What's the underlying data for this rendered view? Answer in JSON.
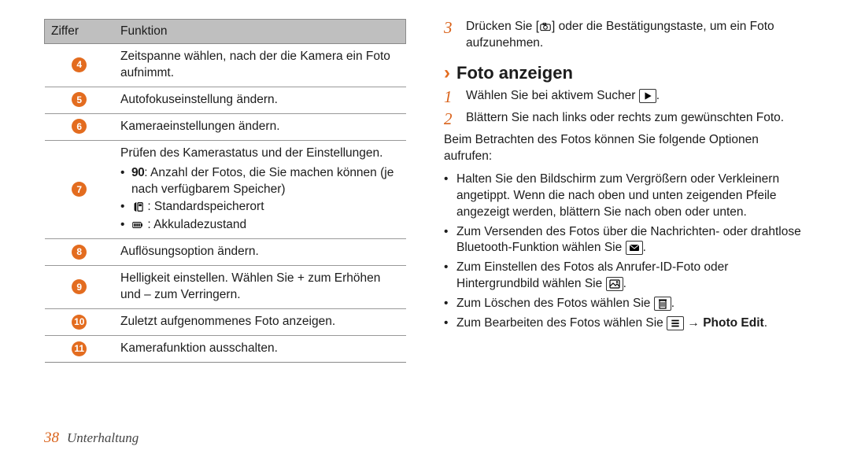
{
  "table": {
    "head": {
      "ziffer": "Ziffer",
      "funktion": "Funktion"
    },
    "rows": [
      {
        "n": "4",
        "text": "Zeitspanne wählen, nach der die Kamera ein Foto aufnimmt."
      },
      {
        "n": "5",
        "text": "Autofokuseinstellung ändern."
      },
      {
        "n": "6",
        "text": "Kameraeinstellungen ändern."
      },
      {
        "n": "7",
        "lead": "Prüfen des Kamerastatus und der Einstellungen.",
        "items": [
          {
            "pre": "90",
            "text": ": Anzahl der Fotos, die Sie machen können (je nach verfügbarem Speicher)"
          },
          {
            "icon": "sd",
            "text": ": Standardspeicherort"
          },
          {
            "icon": "batt",
            "text": ": Akkuladezustand"
          }
        ]
      },
      {
        "n": "8",
        "text": "Auflösungsoption ändern."
      },
      {
        "n": "9",
        "text": "Helligkeit einstellen. Wählen Sie + zum Erhöhen und – zum Verringern."
      },
      {
        "n": "10",
        "text": "Zuletzt aufgenommenes Foto anzeigen."
      },
      {
        "n": "11",
        "text": "Kamerafunktion ausschalten."
      }
    ]
  },
  "right": {
    "step3": {
      "n": "3",
      "pre": "Drücken Sie [",
      "post": "] oder die Bestätigungstaste, um ein Foto aufzunehmen."
    },
    "section": "Foto anzeigen",
    "step1": {
      "n": "1",
      "pre": "Wählen Sie bei aktivem Sucher ",
      "post": "."
    },
    "step2": {
      "n": "2",
      "text": "Blättern Sie nach links oder rechts zum gewünschten Foto."
    },
    "intro": "Beim Betrachten des Fotos können Sie folgende Optionen aufrufen:",
    "opts": [
      {
        "text": "Halten Sie den Bildschirm zum Vergrößern oder Verkleinern angetippt. Wenn die nach oben und unten zeigenden Pfeile angezeigt werden, blättern Sie nach oben oder unten."
      },
      {
        "pre": "Zum Versenden des Fotos über die Nachrichten- oder drahtlose Bluetooth-Funktion wählen Sie ",
        "icon": "send",
        "post": "."
      },
      {
        "pre": "Zum Einstellen des Fotos als Anrufer-ID-Foto oder Hintergrundbild wählen Sie ",
        "icon": "setas",
        "post": "."
      },
      {
        "pre": "Zum Löschen des Fotos wählen Sie ",
        "icon": "trash",
        "post": "."
      },
      {
        "pre": "Zum Bearbeiten des Fotos wählen Sie ",
        "icon": "menu",
        "arrow": " → ",
        "bold": "Photo Edit",
        "post": "."
      }
    ]
  },
  "footer": {
    "page": "38",
    "section": "Unterhaltung"
  }
}
